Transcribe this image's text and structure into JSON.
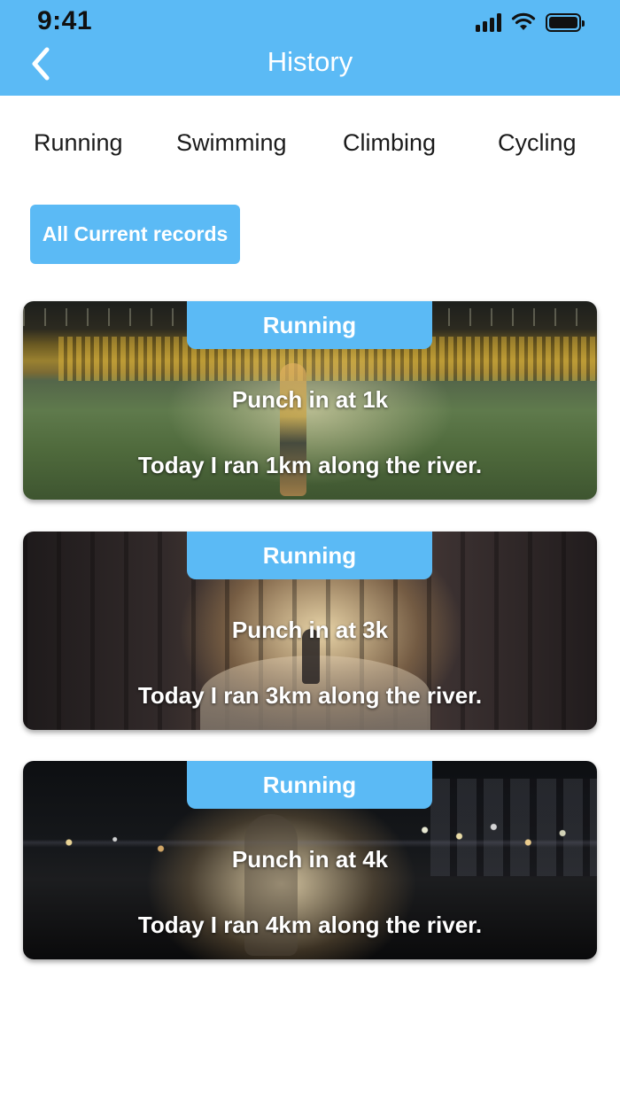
{
  "status_bar": {
    "time": "9:41"
  },
  "header": {
    "title": "History"
  },
  "tabs": [
    {
      "label": "Running"
    },
    {
      "label": "Swimming"
    },
    {
      "label": "Climbing"
    },
    {
      "label": "Cycling"
    }
  ],
  "records_button": {
    "label": "All Current records"
  },
  "cards": [
    {
      "badge": "Running",
      "title": "Punch in at 1k",
      "description": "Today I ran 1km along the river."
    },
    {
      "badge": "Running",
      "title": "Punch in at 3k",
      "description": "Today I ran 3km along the river."
    },
    {
      "badge": "Running",
      "title": "Punch in at 4k",
      "description": "Today I ran 4km along the river."
    }
  ],
  "colors": {
    "accent": "#5bbaf5",
    "text": "#1b1b1b",
    "on_accent": "#ffffff"
  },
  "icons": {
    "back": "chevron-left-icon",
    "signal": "cellular-signal-icon",
    "wifi": "wifi-icon",
    "battery": "battery-icon"
  }
}
